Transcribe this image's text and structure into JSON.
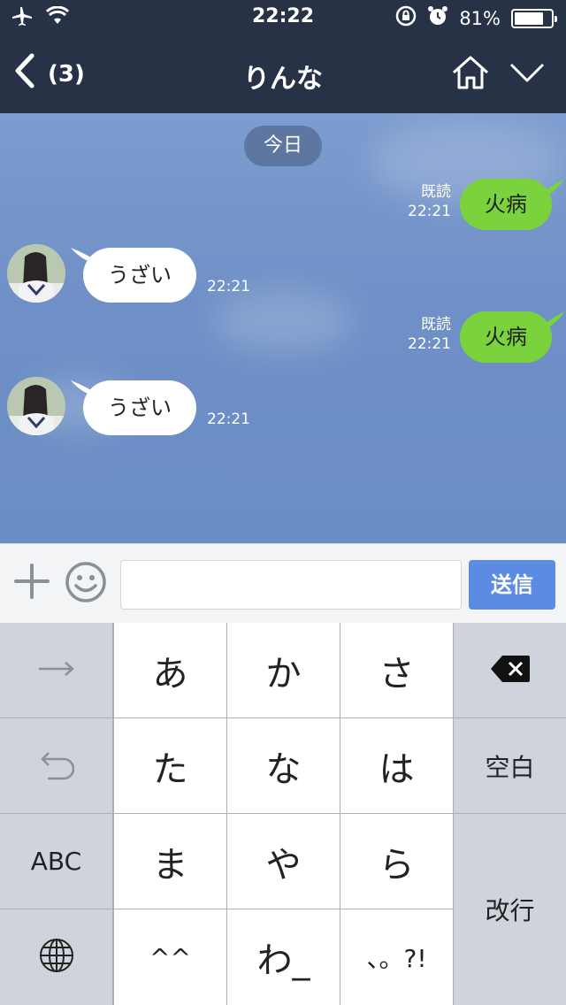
{
  "status_bar": {
    "time": "22:22",
    "battery": "81%",
    "battery_level": 0.81
  },
  "nav": {
    "back_count": "(3)",
    "title": "りんな"
  },
  "chat": {
    "date_label": "今日",
    "messages": [
      {
        "side": "out",
        "text": "火病",
        "read": "既読",
        "time": "22:21"
      },
      {
        "side": "in",
        "text": "うざい",
        "time": "22:21"
      },
      {
        "side": "out",
        "text": "火病",
        "read": "既読",
        "time": "22:21"
      },
      {
        "side": "in",
        "text": "うざい",
        "time": "22:21"
      }
    ]
  },
  "input": {
    "value": "",
    "send_label": "送信"
  },
  "keyboard": {
    "row1": [
      "あ",
      "か",
      "さ"
    ],
    "row2": [
      "た",
      "な",
      "は"
    ],
    "row3": [
      "ま",
      "や",
      "ら"
    ],
    "row4": [
      "^^",
      "わ_",
      "、。?!"
    ],
    "abc_label": "ABC",
    "space_label": "空白",
    "return_label": "改行"
  },
  "colors": {
    "nav_bg": "#283247",
    "bubble_out": "#7ad33d",
    "send_button": "#5b8be2"
  }
}
